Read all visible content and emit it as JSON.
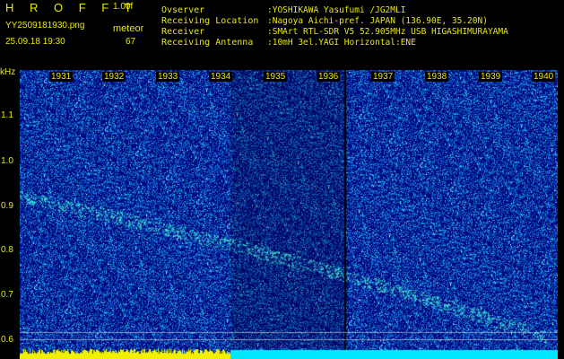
{
  "header": {
    "title": "H R O F F T",
    "version": "1.00f",
    "filename": "YY2509181930.png",
    "datetime": "25.09.18 19:30",
    "mode_label": "meteor",
    "mode_count": "67"
  },
  "info": [
    {
      "key": "Ovserver",
      "value": ":YOSHIKAWA Yasufumi /JG2MLI"
    },
    {
      "key": "Receiving Location",
      "value": ":Nagoya Aichi-pref. JAPAN (136.90E, 35.20N)"
    },
    {
      "key": "Receiver",
      "value": ":SMArt RTL-SDR V5 52.905MHz USB HIGASHIMURAYAMA"
    },
    {
      "key": "Receiving Antenna",
      "value": ":10mH 3el.YAGI Horizontal:ENE"
    }
  ],
  "spectrogram": {
    "unit": "kHz",
    "y_ticks": [
      "1.1",
      "1.0",
      "0.9",
      "0.8",
      "0.7",
      "0.6"
    ],
    "time_labels": [
      "1931",
      "1932",
      "1933",
      "1934",
      "1935",
      "1936",
      "1937",
      "1938",
      "1939",
      "1940"
    ],
    "colors": {
      "background": "#000a80",
      "noise": "#1e6ef0",
      "signal": "#40e0d0",
      "bottom_bar_left": "#f0f000",
      "bottom_bar_right": "#00e8ff"
    }
  }
}
